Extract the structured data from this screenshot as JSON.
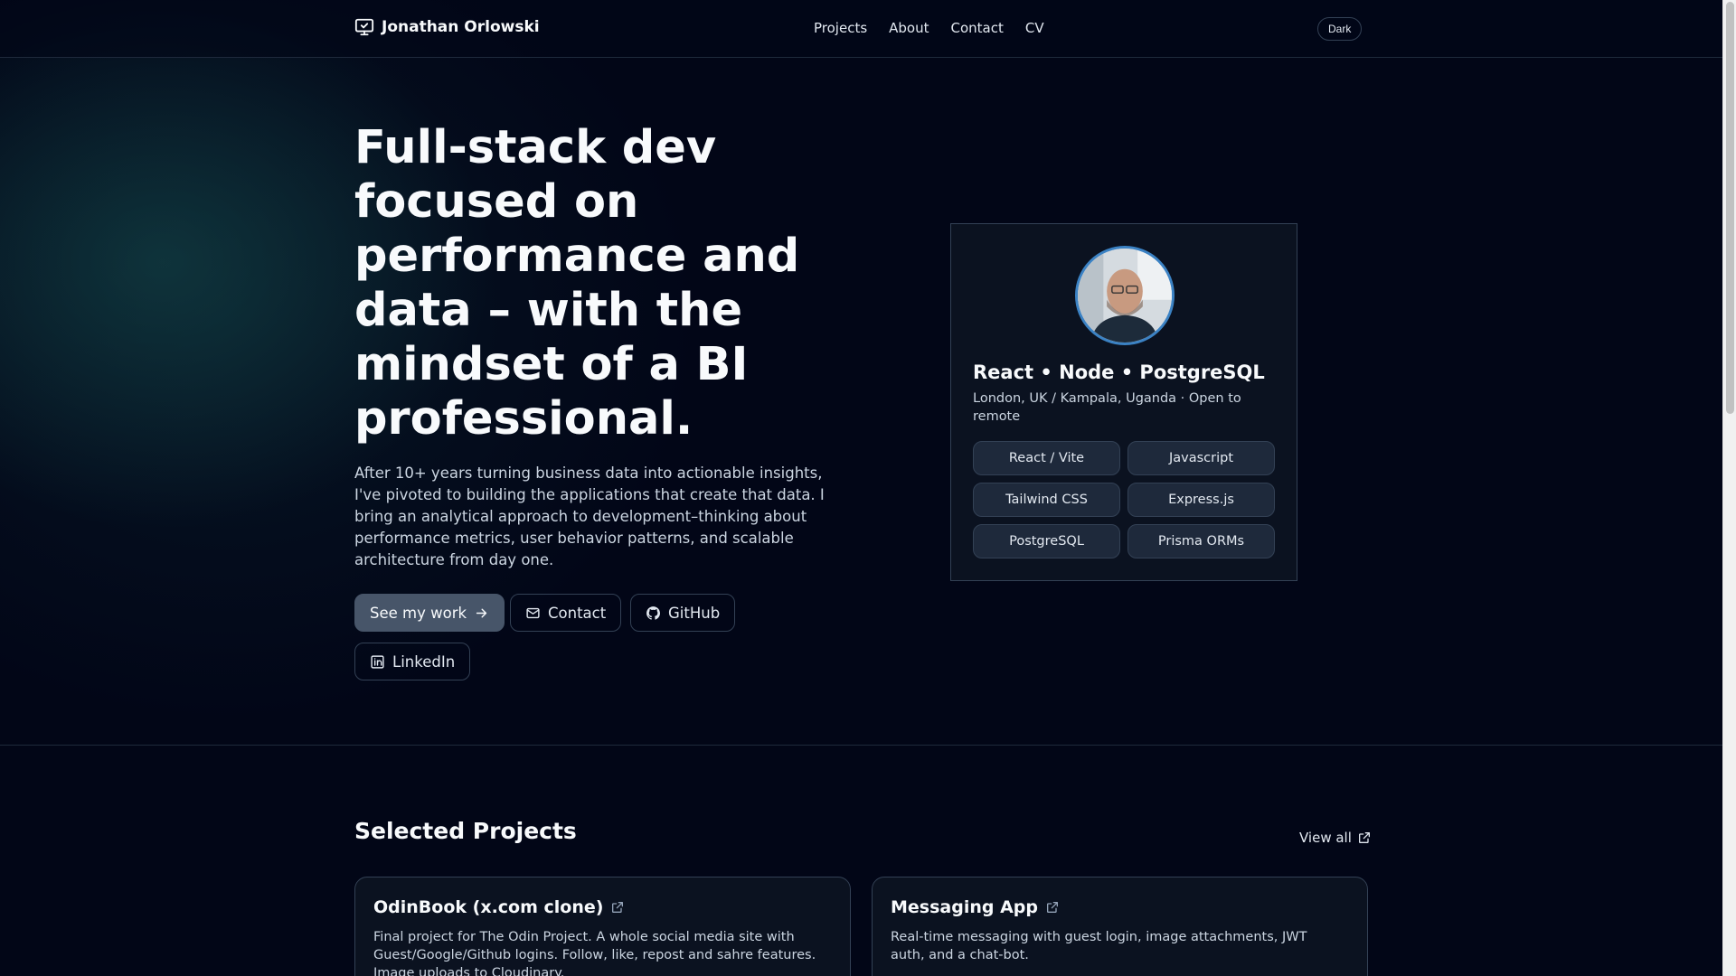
{
  "header": {
    "brand": "Jonathan Orlowski",
    "nav": [
      "Projects",
      "About",
      "Contact",
      "CV"
    ],
    "theme_toggle": "Dark"
  },
  "hero": {
    "title": "Full-stack dev focused on performance and data – with the mindset of a BI professional.",
    "description": "After 10+ years turning business data into actionable insights, I've pivoted to building the applications that create that data. I bring an analytical approach to development–thinking about performance metrics, user behavior patterns, and scalable architecture from day one.",
    "buttons": {
      "see_work": "See my work",
      "contact": "Contact",
      "github": "GitHub",
      "linkedin": "LinkedIn"
    }
  },
  "profile": {
    "stack": "React • Node • PostgreSQL",
    "location": "London, UK / Kampala, Uganda · Open to remote",
    "skills": [
      "React / Vite",
      "Javascript",
      "Tailwind CSS",
      "Express.js",
      "PostgreSQL",
      "Prisma ORMs"
    ]
  },
  "projects_section": {
    "title": "Selected Projects",
    "view_all": "View all",
    "projects": [
      {
        "name": "OdinBook (x.com clone)",
        "description": "Final project for The Odin Project. A whole social media site with Guest/Google/Github logins. Follow, like, repost and sahre features. Image uploads to Cloudinary."
      },
      {
        "name": "Messaging App",
        "description": "Real-time messaging with guest login, image attachments, JWT auth, and a chat-bot."
      }
    ]
  },
  "icons": {
    "brand": "monitor-check-icon",
    "see_work": "arrow-right-icon",
    "contact": "mail-icon",
    "github": "github-icon",
    "linkedin": "linkedin-icon",
    "external": "external-link-icon"
  },
  "colors": {
    "background": "#020617",
    "primary_button": "#475569",
    "border": "#334155",
    "avatar_ring": "#3b82c4"
  }
}
